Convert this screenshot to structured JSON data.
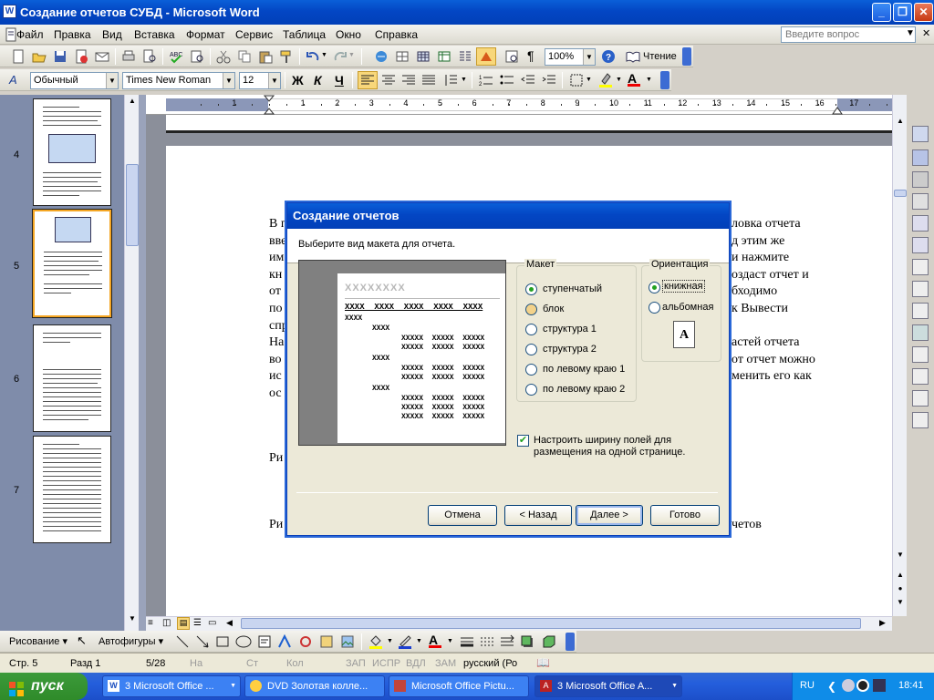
{
  "window": {
    "title": "Создание отчетов СУБД - Microsoft Word"
  },
  "menu": {
    "items": [
      "Файл",
      "Правка",
      "Вид",
      "Вставка",
      "Формат",
      "Сервис",
      "Таблица",
      "Окно",
      "Справка"
    ],
    "ask_placeholder": "Введите вопрос"
  },
  "toolbar_standard": {
    "zoom": "100%",
    "reading_label": "Чтение"
  },
  "toolbar_format": {
    "style": "Обычный",
    "font": "Times New Roman",
    "size": "12"
  },
  "ruler": {
    "marks": [
      "1",
      "1",
      "2",
      "3",
      "4",
      "5",
      "6",
      "7",
      "8",
      "9",
      "10",
      "11",
      "12",
      "13",
      "14",
      "15",
      "16",
      "17"
    ]
  },
  "thumbnails": {
    "pages": [
      "4",
      "5",
      "6",
      "7"
    ],
    "selected": "5"
  },
  "document": {
    "lines": [
      {
        "left": "В п",
        "right": "ловка отчета"
      },
      {
        "left": "вве",
        "right": "д этим же"
      },
      {
        "left": "им",
        "right": "и нажмите"
      },
      {
        "left": "кн",
        "right": "оздаст отчет и"
      },
      {
        "left": "от",
        "right": "бходимо"
      },
      {
        "left": "по",
        "right": "к Вывести"
      },
      {
        "left": "спр",
        "right": ""
      },
      {
        "left": "На",
        "right": "астей отчета"
      },
      {
        "left": "во",
        "right": "от отчет можно"
      },
      {
        "left": "ис",
        "right": "менить его как"
      },
      {
        "left": "ос",
        "right": ""
      }
    ],
    "caption1": "Ри",
    "caption2_left": "Ри",
    "caption2_right": "четов"
  },
  "dialog": {
    "title": "Создание отчетов",
    "prompt": "Выберите вид макета для отчета.",
    "preview": {
      "title": "XXXXXXXX",
      "header_row": "XXXX  XXXX  XXXX  XXXX  XXXX",
      "level1": "XXXX",
      "level2": "XXXX",
      "detail": "XXXXX  XXXXX  XXXXX"
    },
    "layout_group": "Макет",
    "layout_options": [
      {
        "label": "ступенчатый",
        "selected": true
      },
      {
        "label": "блок",
        "selected": false
      },
      {
        "label": "структура 1",
        "selected": false
      },
      {
        "label": "структура 2",
        "selected": false
      },
      {
        "label": "по левому краю 1",
        "selected": false
      },
      {
        "label": "по левому краю 2",
        "selected": false
      }
    ],
    "orientation_group": "Ориентация",
    "orientation_options": [
      {
        "label": "книжная",
        "selected": true
      },
      {
        "label": "альбомная",
        "selected": false
      }
    ],
    "orientation_glyph": "A",
    "checkbox_label_1": "Настроить ширину полей для",
    "checkbox_label_2": "размещения на одной странице.",
    "checkbox_checked": true,
    "buttons": {
      "cancel": "Отмена",
      "back": "< Назад",
      "next": "Далее >",
      "finish": "Готово"
    }
  },
  "drawing_toolbar": {
    "draw_label": "Рисование",
    "autoshapes_label": "Автофигуры"
  },
  "status": {
    "page": "Стр.  5",
    "section": "Разд  1",
    "page_of": "5/28",
    "at": "На",
    "line": "Ст",
    "col": "Кол",
    "rec": "ЗАП",
    "trk": "ИСПР",
    "ext": "ВДЛ",
    "ovr": "ЗАМ",
    "lang": "русский (Ро"
  },
  "taskbar": {
    "start": "пуск",
    "tasks": [
      {
        "label": "3 Microsoft Office ...",
        "active": false
      },
      {
        "label": "DVD  Золотая колле...",
        "active": false
      },
      {
        "label": "Microsoft Office Pictu...",
        "active": false
      },
      {
        "label": "3 Microsoft Office A...",
        "active": true
      }
    ],
    "lang": "RU",
    "clock": "18:41"
  },
  "colors": {
    "titlebar": "#0346c4",
    "taskbar": "#245edc",
    "start": "#2f8b2a",
    "thumb_selected_border": "#f5a623"
  }
}
